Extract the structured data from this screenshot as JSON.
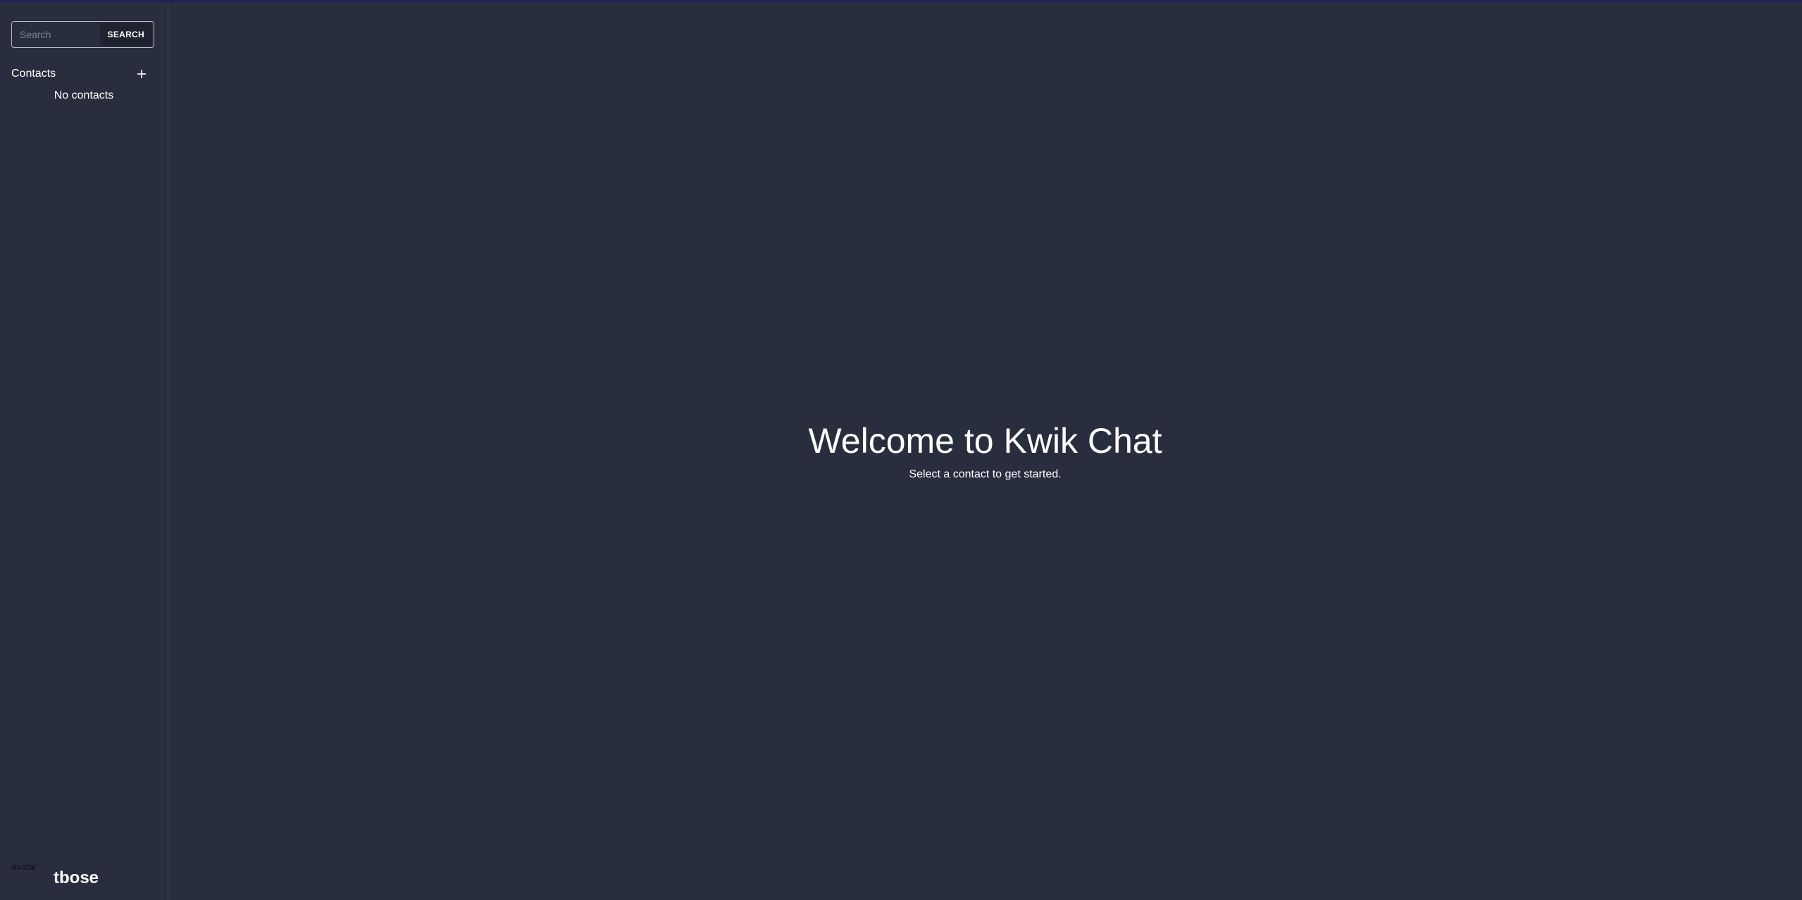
{
  "search": {
    "placeholder": "Search",
    "value": "",
    "button_label": "SEARCH"
  },
  "contacts": {
    "title": "Contacts",
    "add_icon": "plus-icon",
    "empty_text": "No contacts"
  },
  "user": {
    "avatar_alt": "avatar",
    "username": "tbose"
  },
  "main": {
    "title": "Welcome to Kwik Chat",
    "subtitle": "Select a contact to get started."
  },
  "colors": {
    "background": "#282e3e",
    "topbar": "#1c2157",
    "button": "#1f232d"
  }
}
